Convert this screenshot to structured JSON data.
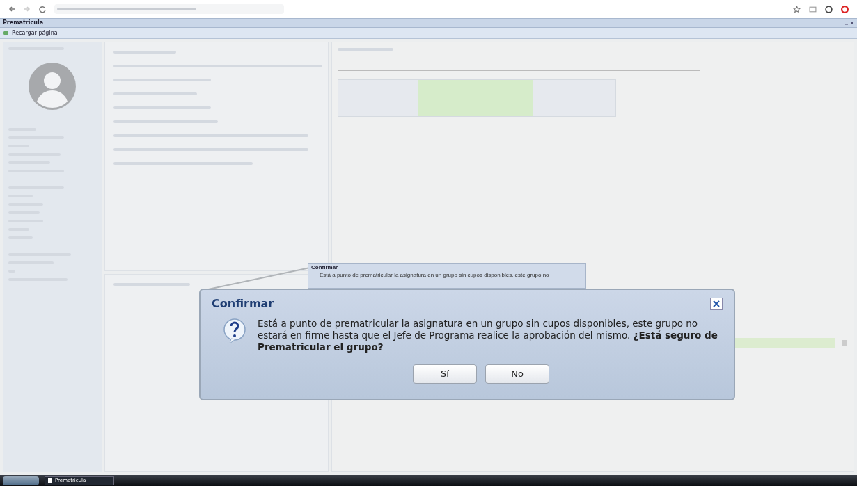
{
  "app": {
    "title": "Prematricula",
    "toolbar_button": "Recargar página"
  },
  "small_dialog": {
    "title": "Confirmar",
    "message": "Está a punto de prematricular la asignatura en un grupo sin cupos disponibles, este grupo no"
  },
  "dialog": {
    "title": "Confirmar",
    "message": "Está a punto de prematricular la asignatura en un grupo sin cupos disponibles, este grupo no estará en firme hasta que el Jefe de Programa realice la aprobación del mismo. **¿Está seguro de Prematricular el grupo?**",
    "buttons": [
      "Sí",
      "No"
    ]
  },
  "taskbar": {
    "items": [
      {
        "label": "Prematricula",
        "selected": true
      }
    ]
  }
}
